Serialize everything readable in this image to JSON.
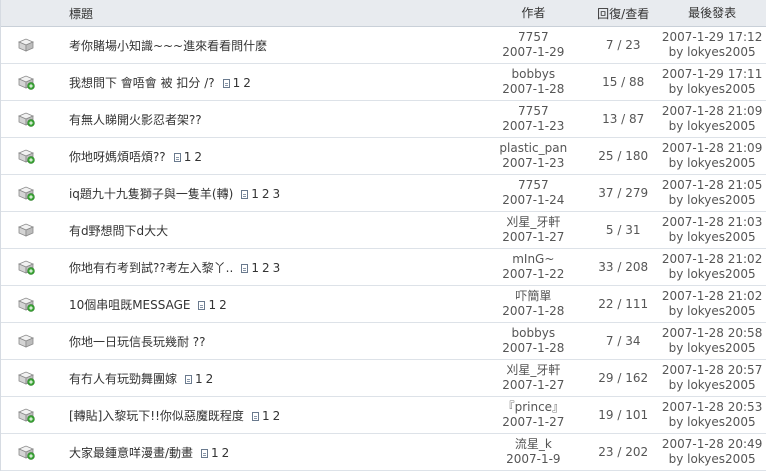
{
  "header": {
    "title": "標題",
    "author": "作者",
    "stats": "回復/查看",
    "last_post": "最後發表"
  },
  "topics": [
    {
      "title": "考你賭場小知識~~~進來看看問什麽",
      "pages": [],
      "new": false,
      "author": "7757",
      "date": "2007-1-29",
      "stats": "7 / 23",
      "last_time": "2007-1-29 17:12",
      "last_by": "by lokyes2005"
    },
    {
      "title": "我想問下 會唔會 被 扣分 /?",
      "pages": [
        "1",
        "2"
      ],
      "new": true,
      "author": "bobbys",
      "date": "2007-1-28",
      "stats": "15 / 88",
      "last_time": "2007-1-29 17:11",
      "last_by": "by lokyes2005"
    },
    {
      "title": "有無人睇開火影忍者架??",
      "pages": [],
      "new": true,
      "author": "7757",
      "date": "2007-1-23",
      "stats": "13 / 87",
      "last_time": "2007-1-28 21:09",
      "last_by": "by lokyes2005"
    },
    {
      "title": "你地呀媽煩唔煩??",
      "pages": [
        "1",
        "2"
      ],
      "new": true,
      "author": "plastic_pan",
      "date": "2007-1-23",
      "stats": "25 / 180",
      "last_time": "2007-1-28 21:09",
      "last_by": "by lokyes2005"
    },
    {
      "title": "iq題九十九隻獅子與一隻羊(轉)",
      "pages": [
        "1",
        "2",
        "3"
      ],
      "new": true,
      "author": "7757",
      "date": "2007-1-24",
      "stats": "37 / 279",
      "last_time": "2007-1-28 21:05",
      "last_by": "by lokyes2005"
    },
    {
      "title": "有d野想問下d大大",
      "pages": [],
      "new": false,
      "author": "刈星_牙軒",
      "date": "2007-1-27",
      "stats": "5 / 31",
      "last_time": "2007-1-28 21:03",
      "last_by": "by lokyes2005"
    },
    {
      "title": "你地有冇考到試??考左入黎丫..",
      "pages": [
        "1",
        "2",
        "3"
      ],
      "new": true,
      "author": "mInG~",
      "date": "2007-1-22",
      "stats": "33 / 208",
      "last_time": "2007-1-28 21:02",
      "last_by": "by lokyes2005"
    },
    {
      "title": "10個串咀既MESSAGE",
      "pages": [
        "1",
        "2"
      ],
      "new": true,
      "author": "吓簡單",
      "date": "2007-1-28",
      "stats": "22 / 111",
      "last_time": "2007-1-28 21:02",
      "last_by": "by lokyes2005"
    },
    {
      "title": "你地一日玩信長玩幾耐 ??",
      "pages": [],
      "new": false,
      "author": "bobbys",
      "date": "2007-1-28",
      "stats": "7 / 34",
      "last_time": "2007-1-28 20:58",
      "last_by": "by lokyes2005"
    },
    {
      "title": "有冇人有玩勁舞團嫁",
      "pages": [
        "1",
        "2"
      ],
      "new": true,
      "author": "刈星_牙軒",
      "date": "2007-1-27",
      "stats": "29 / 162",
      "last_time": "2007-1-28 20:57",
      "last_by": "by lokyes2005"
    },
    {
      "title": "[轉貼]入黎玩下!!你似惡魔既程度",
      "pages": [
        "1",
        "2"
      ],
      "new": true,
      "author": "『prince』",
      "date": "2007-1-27",
      "stats": "19 / 101",
      "last_time": "2007-1-28 20:53",
      "last_by": "by lokyes2005"
    },
    {
      "title": "大家最鍾意咩漫畫/動畫",
      "pages": [
        "1",
        "2"
      ],
      "new": true,
      "author": "流星_k",
      "date": "2007-1-9",
      "stats": "23 / 202",
      "last_time": "2007-1-28 20:49",
      "last_by": "by lokyes2005"
    }
  ],
  "icons": {
    "topic": "folder-icon",
    "topic_new": "folder-new-icon",
    "multipage": "document-icon"
  }
}
